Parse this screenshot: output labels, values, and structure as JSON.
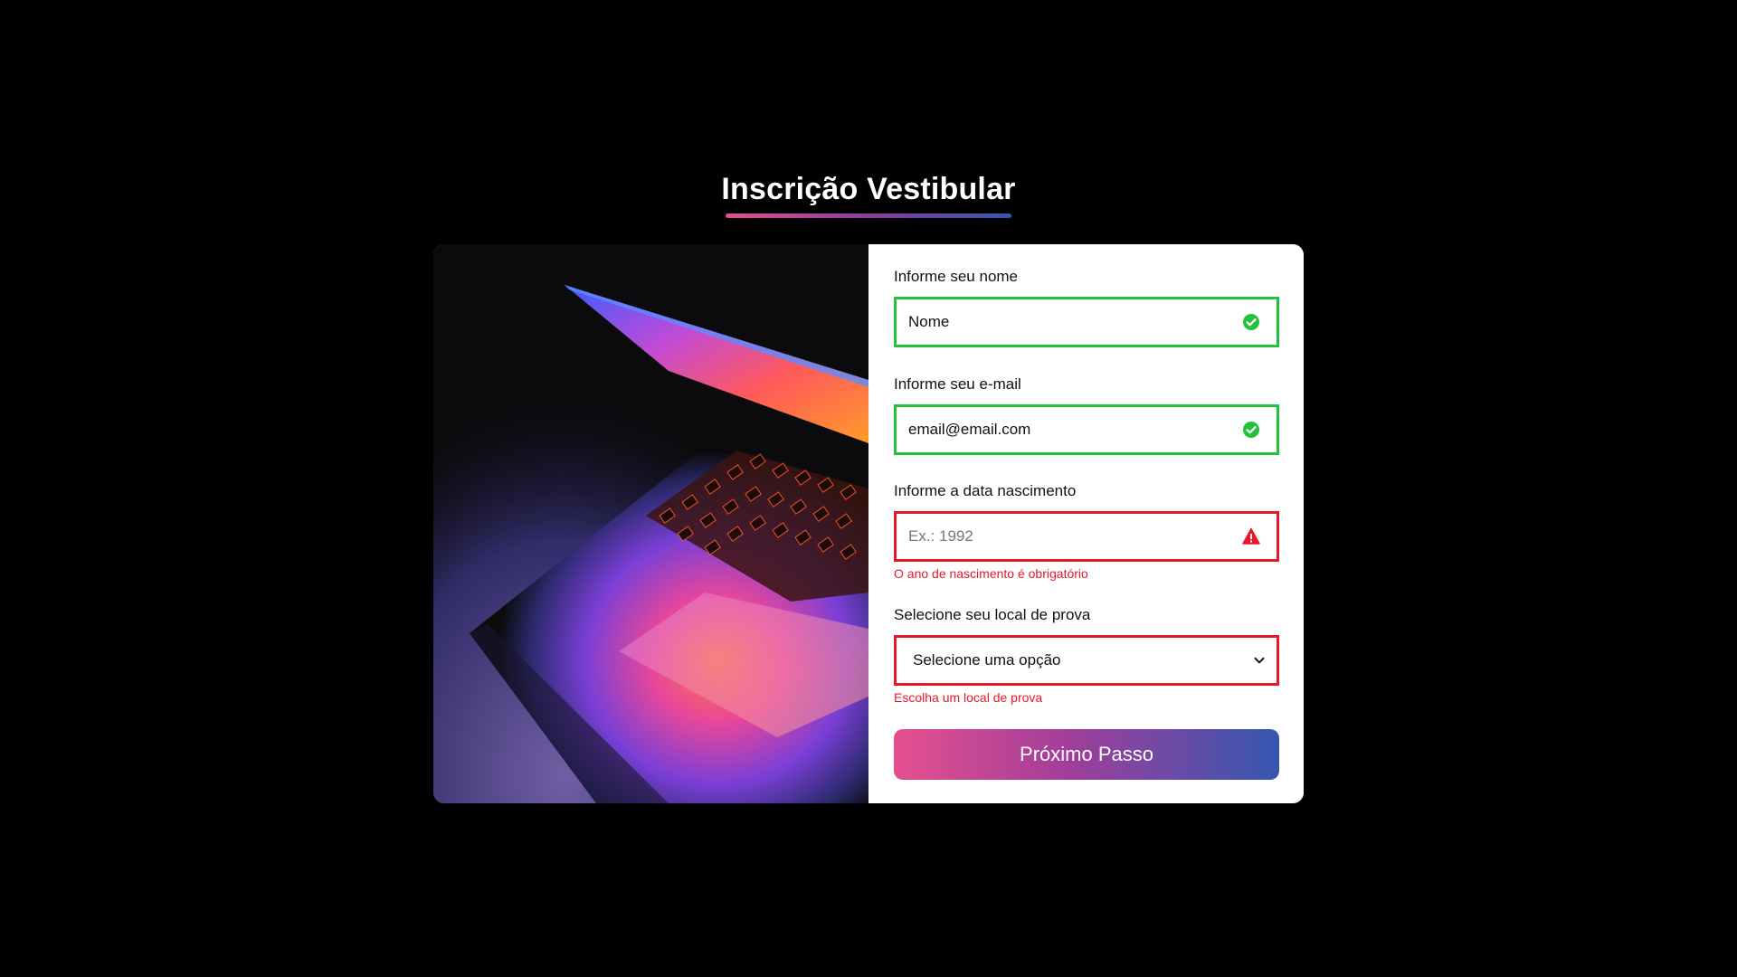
{
  "page": {
    "title": "Inscrição Vestibular",
    "background": "#000000",
    "accent_gradient": [
      "#e5508f",
      "#3557b0"
    ]
  },
  "hero_image": {
    "description_icon": "laptop-photo"
  },
  "form": {
    "name": {
      "label": "Informe seu nome",
      "value": "Nome",
      "status": "valid",
      "status_icon": "check-circle-icon"
    },
    "email": {
      "label": "Informe seu e-mail",
      "value": "email@email.com",
      "status": "valid",
      "status_icon": "check-circle-icon"
    },
    "birth_year": {
      "label": "Informe a data nascimento",
      "value": "",
      "placeholder": "Ex.: 1992",
      "status": "error",
      "status_icon": "warning-triangle-icon",
      "error": "O ano de nascimento é obrigatório"
    },
    "exam_location": {
      "label": "Selecione seu local de prova",
      "selected": "Selecione uma opção",
      "status": "error",
      "error": "Escolha um local de prova"
    },
    "submit_label": "Próximo Passo"
  },
  "colors": {
    "valid": "#22c33a",
    "error": "#e5192b"
  }
}
